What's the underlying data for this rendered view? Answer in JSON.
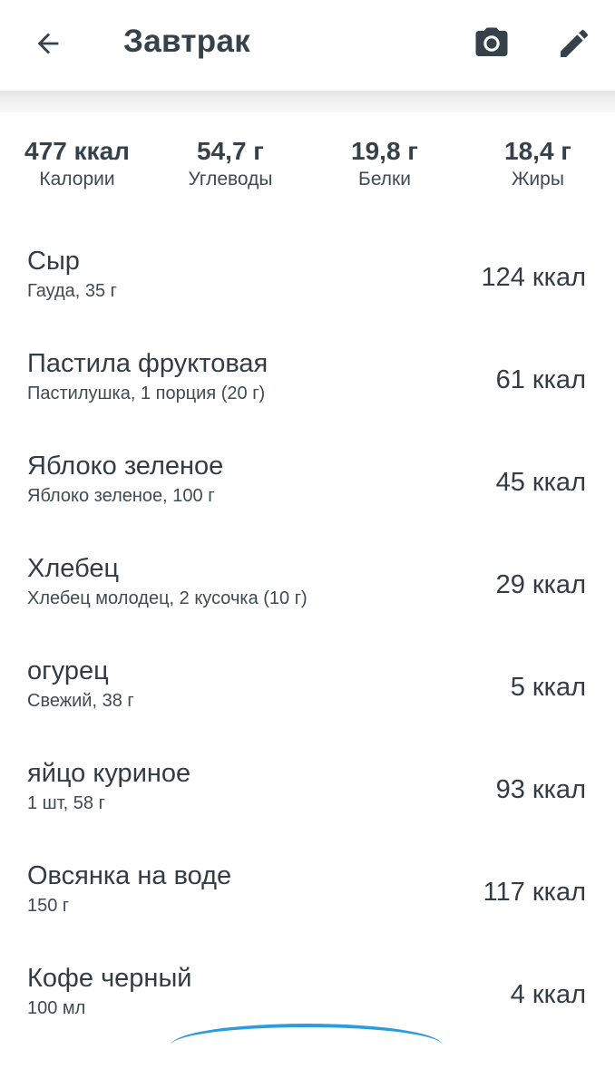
{
  "header": {
    "title": "Завтрак",
    "back_icon": "arrow-back-icon",
    "camera_icon": "camera-icon",
    "edit_icon": "pencil-icon"
  },
  "summary": [
    {
      "value": "477 ккал",
      "label": "Калории"
    },
    {
      "value": "54,7 г",
      "label": "Углеводы"
    },
    {
      "value": "19,8 г",
      "label": "Белки"
    },
    {
      "value": "18,4 г",
      "label": "Жиры"
    }
  ],
  "foods": [
    {
      "name": "Сыр",
      "desc": "Гауда, 35 г",
      "kcal": "124 ккал"
    },
    {
      "name": "Пастила фруктовая",
      "desc": "Пастилушка, 1 порция (20 г)",
      "kcal": "61 ккал"
    },
    {
      "name": "Яблоко зеленое",
      "desc": "Яблоко зеленое, 100 г",
      "kcal": "45 ккал"
    },
    {
      "name": "Хлебец",
      "desc": "Хлебец молодец, 2 кусочка (10 г)",
      "kcal": "29 ккал"
    },
    {
      "name": "огурец",
      "desc": "Свежий, 38 г",
      "kcal": "5 ккал"
    },
    {
      "name": "яйцо куриное",
      "desc": "1 шт, 58 г",
      "kcal": "93 ккал"
    },
    {
      "name": "Овсянка на воде",
      "desc": "150 г",
      "kcal": "117 ккал"
    },
    {
      "name": "Кофе черный",
      "desc": "100 мл",
      "kcal": "4 ккал"
    }
  ],
  "colors": {
    "text_dark": "#36424b",
    "accent": "#2a9de0"
  }
}
